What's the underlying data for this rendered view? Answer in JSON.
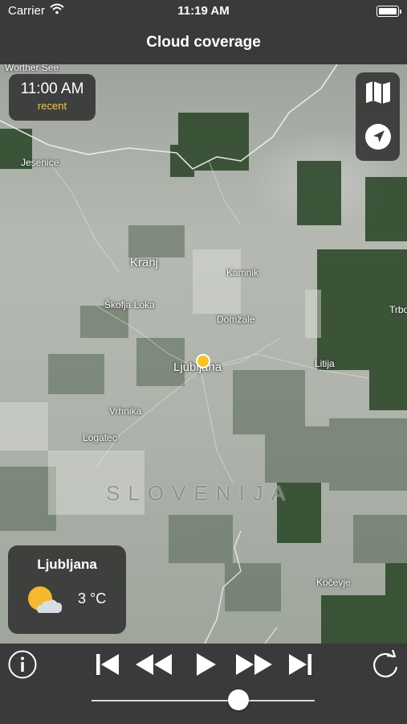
{
  "status_bar": {
    "carrier": "Carrier",
    "time": "11:19 AM"
  },
  "nav": {
    "title": "Cloud coverage"
  },
  "time_panel": {
    "time": "11:00 AM",
    "label": "recent"
  },
  "map": {
    "places": {
      "worther_see": "Worther See",
      "jesenice": "Jesenice",
      "kranj": "Kranj",
      "kamnik": "Kamnik",
      "skofja_loka": "Škofja Loka",
      "domzale": "Domžale",
      "ljubljana": "Ljubljana",
      "litija": "Litija",
      "trbovlje": "Trbo",
      "vrhnika": "Vrhnika",
      "logatec": "Logatec",
      "kocevje": "Kočevje"
    },
    "country": "SLOVENIJA"
  },
  "weather_card": {
    "city": "Ljubljana",
    "temperature": "3 °C",
    "icon": "partly-cloudy-icon"
  },
  "playback": {
    "slider_fraction": 0.66
  },
  "colors": {
    "accent": "#f3c84a",
    "bar": "#3a3a3a",
    "pin": "#f6c328"
  }
}
